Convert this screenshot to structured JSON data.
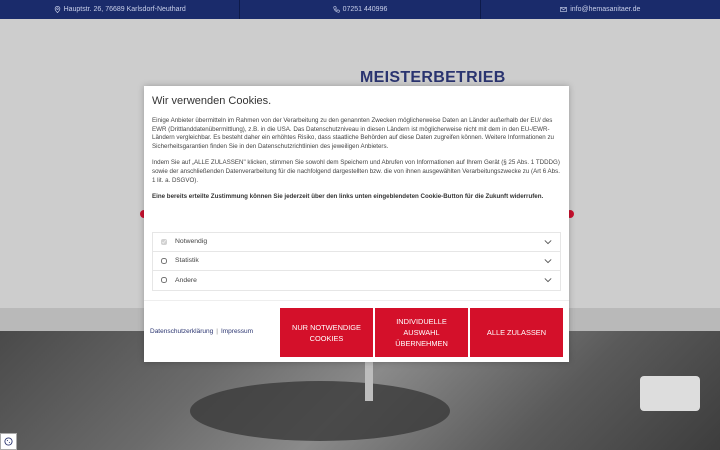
{
  "topbar": {
    "address": "Hauptstr. 26, 76689 Karlsdorf-Neuthard",
    "phone": "07251 440996",
    "email": "info@hemasanitaer.de"
  },
  "background": {
    "logo_text": "MEISTERBETRIEB"
  },
  "cookie_dialog": {
    "title": "Wir verwenden Cookies.",
    "paragraph1": "Einige Anbieter übermitteln im Rahmen von der Verarbeitung zu den genannten Zwecken möglicherweise Daten an Länder außerhalb der EU/ des EWR (Drittlanddatenübermittlung), z.B. in die USA. Das Datenschutzniveau in diesen Ländern ist möglicherweise nicht mit dem in den EU-/EWR-Ländern vergleichbar. Es besteht daher ein erhöhtes Risiko, dass staatliche Behörden auf diese Daten zugreifen können. Weitere Informationen zu Sicherheitsgarantien finden Sie in den Datenschutzrichtlinien des jeweiligen Anbieters.",
    "paragraph2": "Indem Sie auf „ALLE ZULASSEN\" klicken, stimmen Sie sowohl dem Speichern und Abrufen von Informationen auf Ihrem Gerät (§ 25 Abs. 1 TDDDG) sowie der anschließenden Datenverarbeitung für die nachfolgend dargestellten bzw. die von ihnen ausgewählten Verarbeitungszwecke zu (Art 6 Abs. 1 lit. a. DSGVO).",
    "paragraph3": "Eine bereits erteilte Zustimmung können Sie jederzeit über den links unten eingeblendeten Cookie-Button für die Zukunft widerrufen.",
    "categories": [
      {
        "label": "Notwendig",
        "checked": true,
        "disabled": true
      },
      {
        "label": "Statistik",
        "checked": false,
        "disabled": false
      },
      {
        "label": "Andere",
        "checked": false,
        "disabled": false
      }
    ],
    "link_privacy": "Datenschutzerklärung",
    "link_separator": "|",
    "link_imprint": "Impressum",
    "btn_necessary": "NUR NOTWENDIGE COOKIES",
    "btn_individual": "INDIVIDUELLE AUSWAHL ÜBERNEHMEN",
    "btn_all": "ALLE ZULASSEN"
  },
  "colors": {
    "topbar_bg": "#1a2b6b",
    "accent_red": "#d4102a",
    "link_blue": "#2a3470"
  }
}
